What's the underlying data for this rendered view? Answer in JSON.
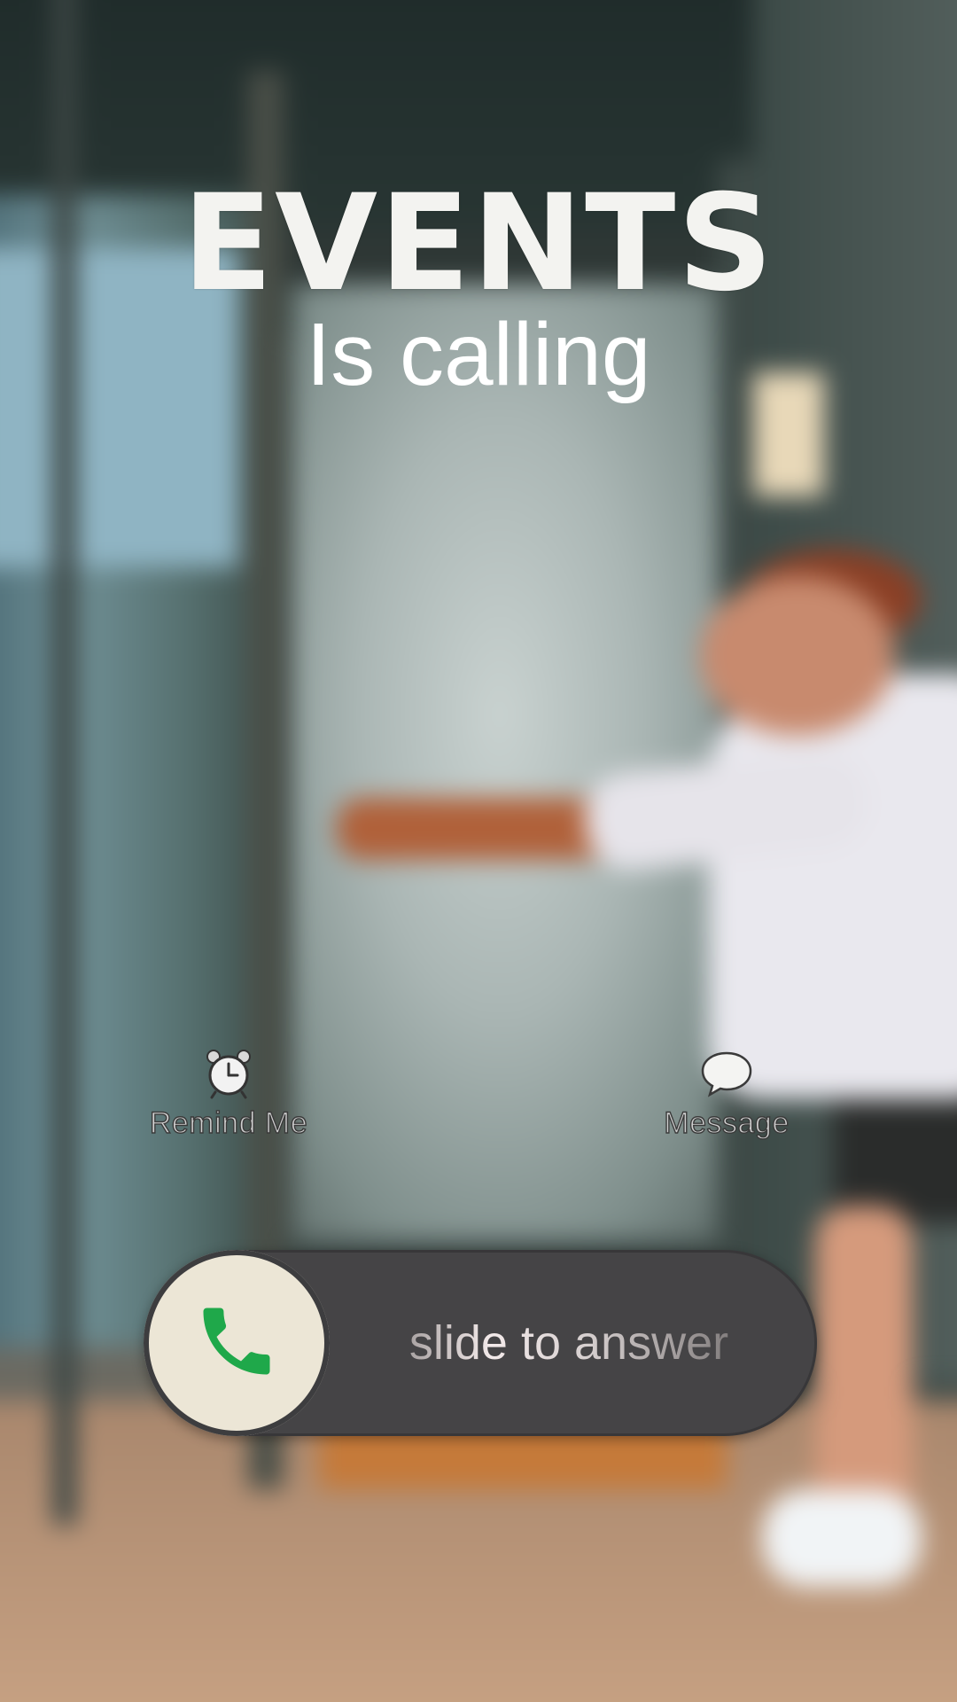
{
  "call": {
    "caller_name": "EVENTS",
    "status_text": "Is calling"
  },
  "actions": {
    "remind_me": {
      "label": "Remind Me",
      "icon": "alarm-clock-icon"
    },
    "message": {
      "label": "Message",
      "icon": "speech-bubble-icon"
    }
  },
  "slider": {
    "label": "slide to answer",
    "icon": "phone-icon",
    "colors": {
      "track": "#454446",
      "knob": "#ece6d6",
      "phone_icon": "#1fa84a"
    }
  }
}
